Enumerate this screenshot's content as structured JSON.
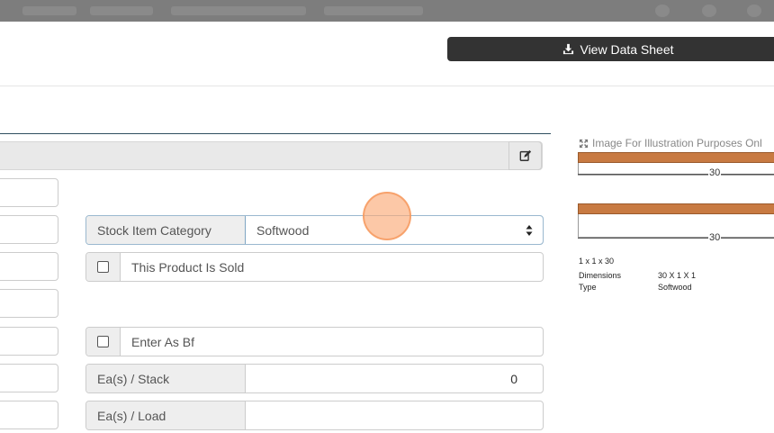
{
  "colors": {
    "button_dark": "#333333",
    "addon_bg": "#eeeeee",
    "board": "#c87a42",
    "click": "#faaa78"
  },
  "view_button": {
    "label": "View Data Sheet",
    "icon": "download-icon"
  },
  "panel": {
    "edit_icon": "edit-icon"
  },
  "form": {
    "category": {
      "label": "Stock Item Category",
      "value": "Softwood"
    },
    "sold": {
      "label": "This Product Is Sold",
      "checked": false
    },
    "enter_bf": {
      "label": "Enter As Bf",
      "checked": false
    },
    "ea_stack": {
      "label": "Ea(s) / Stack",
      "value": "0"
    },
    "ea_load": {
      "label": "Ea(s) / Load",
      "value": ""
    }
  },
  "illustration": {
    "caption": "Image For Illustration Purposes Onl",
    "caption_icon": "expand-icon",
    "dim_top": "30",
    "dim_bottom": "30",
    "title": "1 x 1 x 30",
    "specs": [
      {
        "key": "Dimensions",
        "value": "30 X 1 X 1"
      },
      {
        "key": "Type",
        "value": "Softwood"
      }
    ]
  }
}
